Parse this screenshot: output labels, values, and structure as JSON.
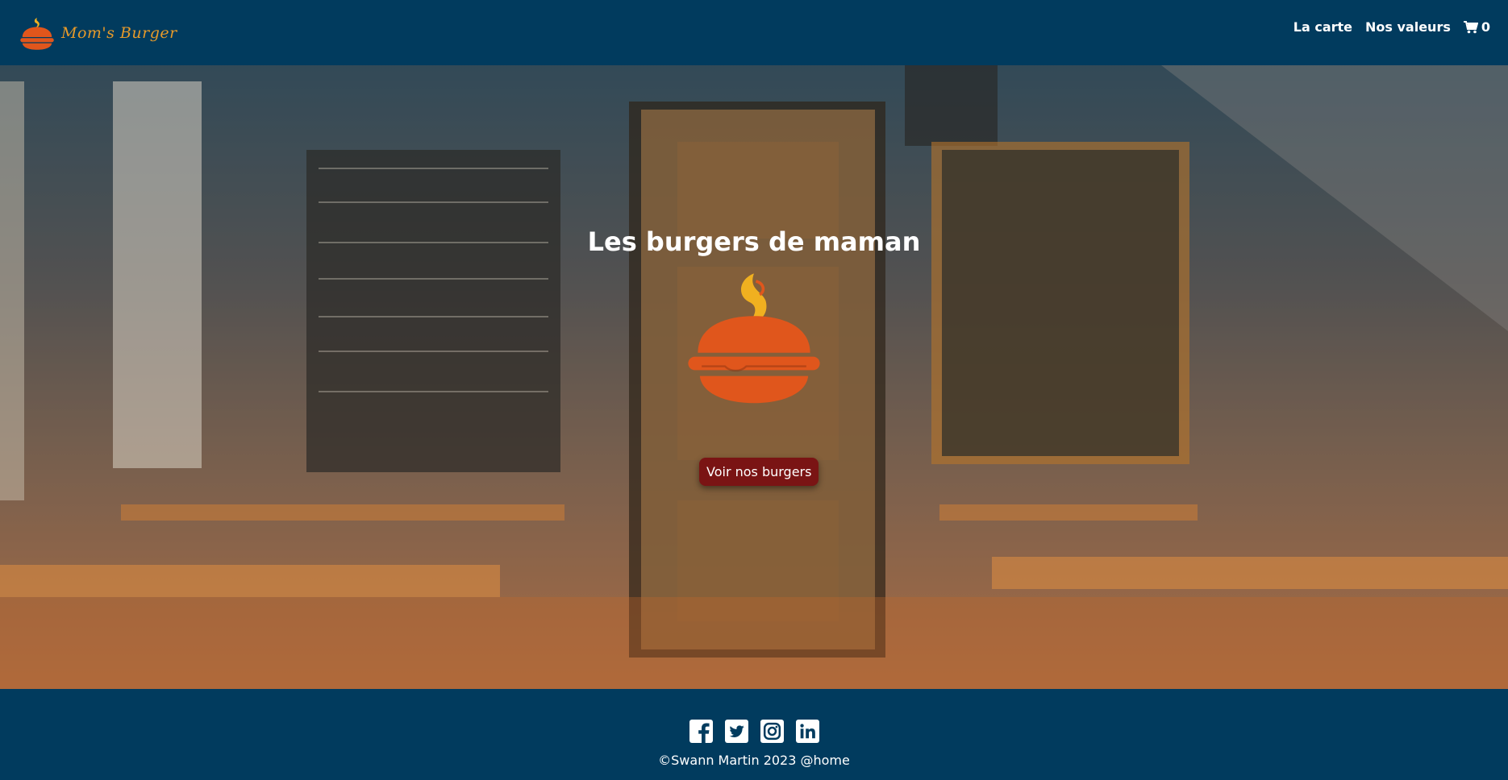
{
  "brand": {
    "name": "Mom's Burger",
    "icon": "burger-logo-icon"
  },
  "nav": {
    "links": [
      "La carte",
      "Nos valeurs"
    ],
    "cart_icon": "shopping-cart-icon",
    "cart_count": "0"
  },
  "hero": {
    "title": "Les burgers de maman",
    "cta_label": "Voir nos burgers",
    "logo_icon": "burger-logo-icon",
    "background_image": "restaurant-interior-photo"
  },
  "footer": {
    "socials": [
      "facebook-icon",
      "twitter-icon",
      "instagram-icon",
      "linkedin-icon"
    ],
    "copyright": "©Swann Martin 2023 @home"
  },
  "colors": {
    "navy": "#013b5e",
    "accent_orange": "#e0561c",
    "logo_yellow": "#f0b020",
    "cta_red": "#7a1414",
    "brand_gold": "#e69a2a"
  }
}
